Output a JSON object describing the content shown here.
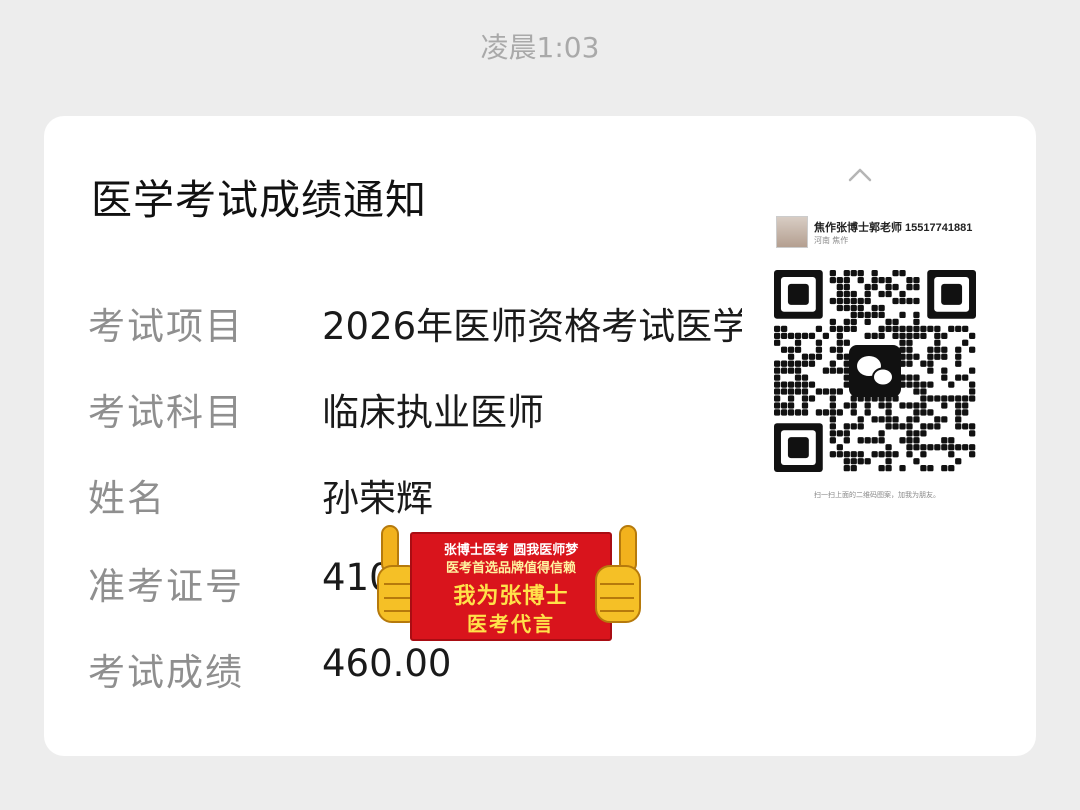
{
  "status_bar": {
    "time": "凌晨1:03"
  },
  "notice": {
    "title": "医学考试成绩通知",
    "rows": [
      {
        "label": "考试项目",
        "value": "2026年医师资格考试医学"
      },
      {
        "label": "考试科目",
        "value": "临床执业医师"
      },
      {
        "label": "姓名",
        "value": "孙荣辉"
      },
      {
        "label": "准考证号",
        "value": "410"
      },
      {
        "label": "考试成绩",
        "value": "460.00"
      }
    ]
  },
  "qr_card": {
    "name": "焦作张博士郭老师 15517741881",
    "region": "河南 焦作",
    "caption": "扫一扫上面的二维码图案，加我为朋友。"
  },
  "promo_banner": {
    "line1": "张博士医考  圆我医师梦",
    "line2": "医考首选品牌值得信赖",
    "line3": "我为张博士",
    "line4": "医考代言",
    "colors": {
      "flag": "#d9141c",
      "text": "#ffe24a"
    }
  },
  "icons": [
    "chevron-up-icon",
    "wechat-icon",
    "thumbs-up-icon"
  ]
}
